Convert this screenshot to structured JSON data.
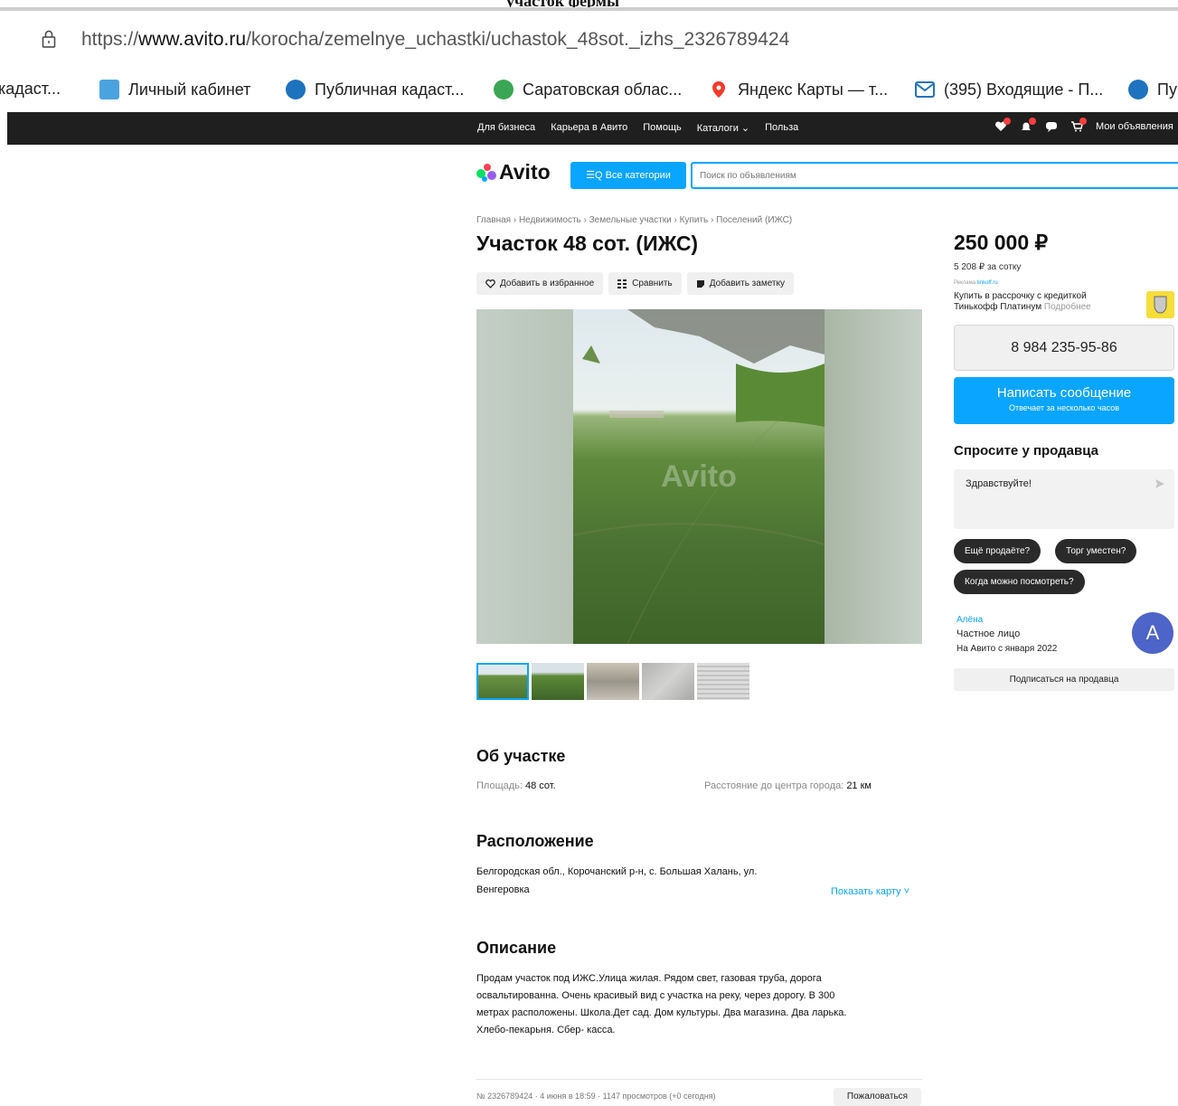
{
  "top_strip_text": "участок фермы",
  "browser": {
    "url_prefix": "https://",
    "url_host": "www.avito.ru",
    "url_path": "/korocha/zemelnye_uchastki/uchastok_48sot._izhs_2326789424"
  },
  "bookmarks": [
    {
      "label": "кадаст...",
      "icon_color": "#ffffff"
    },
    {
      "label": "Личный кабинет",
      "icon_color": "#2e86de"
    },
    {
      "label": "Публичная кадаст...",
      "icon_color": "#1e73be"
    },
    {
      "label": "Саратовская облас...",
      "icon_color": "#3aa655"
    },
    {
      "label": "Яндекс Карты — т...",
      "icon_color": "#f33a2b"
    },
    {
      "label": "(395) Входящие - П...",
      "icon_color": "#1e73be"
    },
    {
      "label": "Пу",
      "icon_color": "#1e73be"
    }
  ],
  "topnav": [
    "Для бизнеса",
    "Карьера в Авито",
    "Помощь",
    "Каталоги ⌄",
    "Польза"
  ],
  "my_ads": "Мои объявления",
  "header": {
    "logo": "Avito",
    "categories_button": "☰Q Все категории",
    "search_placeholder": "Поиск по объявлениям"
  },
  "breadcrumbs": "Главная › Недвижимость › Земельные участки › Купить › Поселений (ИЖС)",
  "title": "Участок 48 сот. (ИЖС)",
  "actions": {
    "favorite": "Добавить в избранное",
    "compare": "Сравнить",
    "note": "Добавить заметку"
  },
  "gallery_watermark": "Avito",
  "price": {
    "value": "250 000 ₽",
    "per_sotka": "5 208 ₽ за сотку"
  },
  "ad": {
    "tag": "Реклама",
    "source": "tinkoff.ru",
    "line1": "Купить в рассрочку с кредиткой",
    "line2": "Тинькофф Платинум",
    "more": "Подробнее"
  },
  "phone": "8 984 235-95-86",
  "message_button": {
    "label": "Написать сообщение",
    "sub": "Отвечает за несколько часов"
  },
  "ask": {
    "title": "Спросите у продавца",
    "text": "Здравствуйте!",
    "chips": [
      "Ещё продаёте?",
      "Торг уместен?",
      "Когда можно посмотреть?"
    ]
  },
  "seller": {
    "name": "Алёна",
    "type": "Частное лицо",
    "since": "На Авито с января 2022",
    "avatar_letter": "A",
    "subscribe": "Подписаться на продавца"
  },
  "about": {
    "title": "Об участке",
    "area_label": "Площадь:",
    "area_value": "48 сот.",
    "distance_label": "Расстояние до центра города:",
    "distance_value": "21 км"
  },
  "location": {
    "title": "Расположение",
    "line1": "Белгородская обл., Корочанский р-н, с. Большая Халань, ул.",
    "line2": "Венгеровка",
    "show_map": "Показать карту ˅"
  },
  "description": {
    "title": "Описание",
    "lines": [
      "Продам участок под ИЖС.Улица жилая. Рядом свет, газовая труба, дорога",
      "освальтированна. Очень красивый вид с участка на реку, через дорогу. В 300",
      "метрах расположены. Школа.Дет сад. Дом культуры. Два магазина. Два ларька.",
      "Хлебо-пекарьня. Сбер- касса."
    ]
  },
  "footer": {
    "meta": "№ 2326789424 · 4 июня в 18:59 · 1147 просмотров (+0 сегодня)",
    "complain": "Пожаловаться"
  },
  "colors": {
    "accent": "#0aa5ff",
    "dark_bar": "#1f1f1f",
    "avatar": "#4d64c8"
  }
}
